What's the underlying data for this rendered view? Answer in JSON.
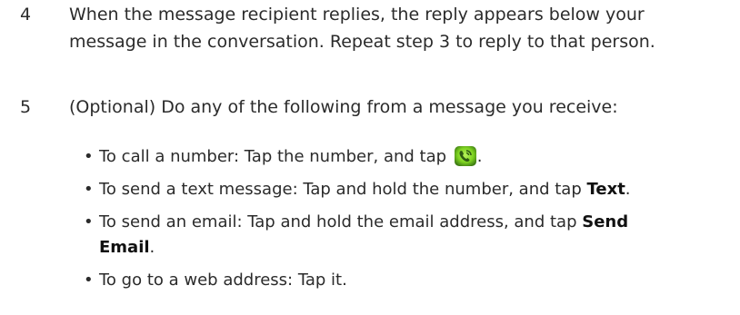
{
  "steps": [
    {
      "number": "4",
      "line1": "When the message recipient replies, the reply appears below your",
      "line2": "message in the conversation. Repeat step 3 to reply to that person."
    },
    {
      "number": "5",
      "line1": "(Optional) Do any of the following from a message you receive:"
    }
  ],
  "bullets": [
    {
      "text": "To call a number: Tap the number, and tap ",
      "icon": "phone-call-icon",
      "after": "."
    },
    {
      "text": "To send a text message: Tap and hold the number, and tap ",
      "bold": "Text",
      "after": "."
    },
    {
      "text": "To send an email: Tap and hold the email address, and tap ",
      "bold1": "Send",
      "bold2": "Email",
      "after": "."
    },
    {
      "text": "To go to a web address: Tap it."
    }
  ],
  "colors": {
    "text": "#2b2b2b",
    "icon_green": "#7ed321",
    "icon_dark": "#2e5a12"
  }
}
